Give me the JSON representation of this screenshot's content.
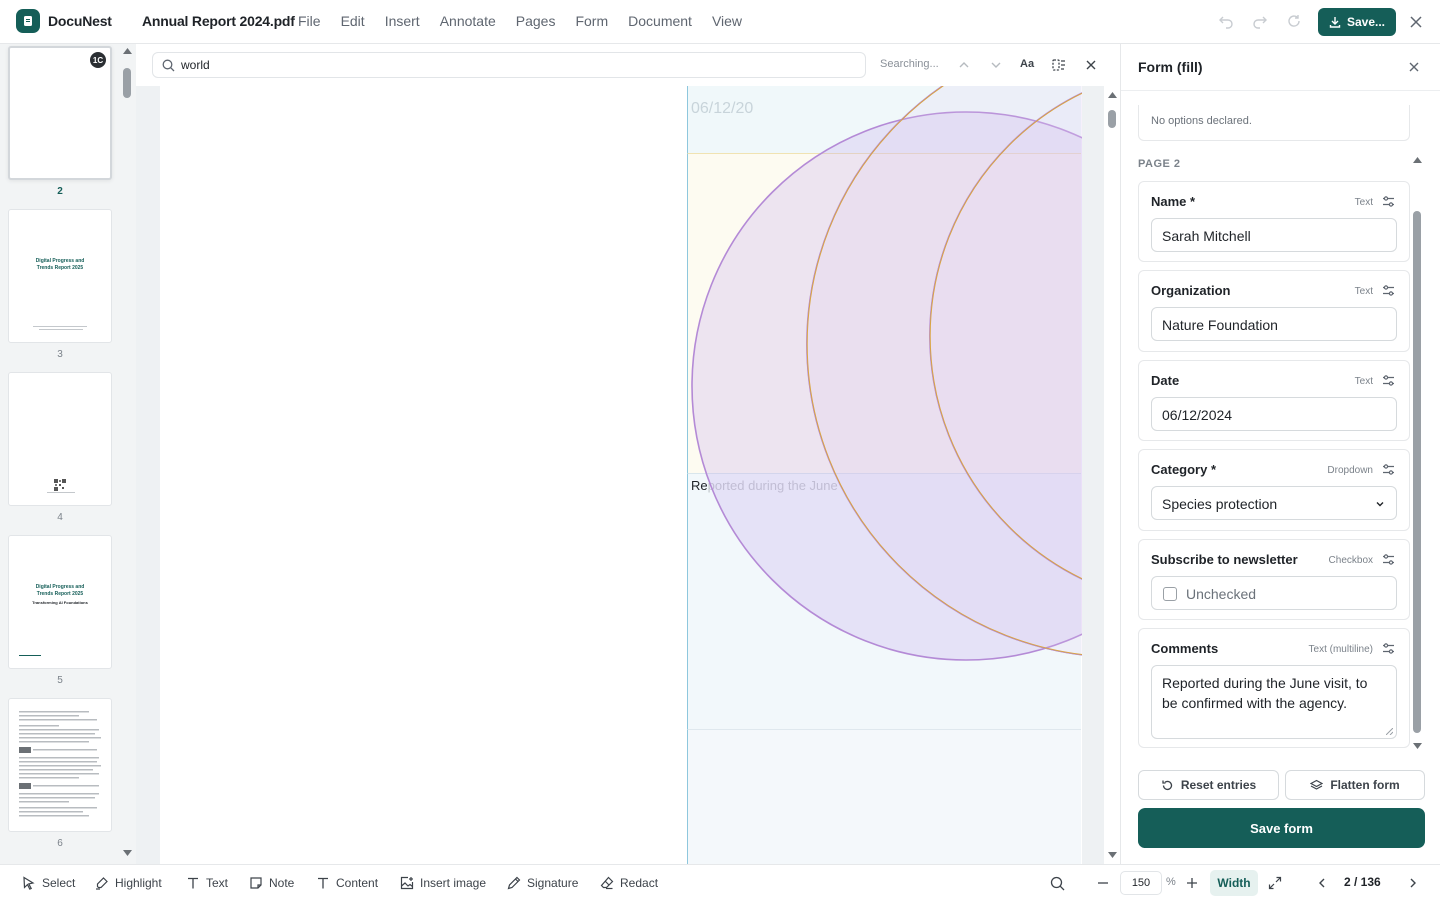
{
  "app": {
    "name": "DocuNest",
    "document": "Annual Report 2024.pdf"
  },
  "menu": [
    "File",
    "Edit",
    "Insert",
    "Annotate",
    "Pages",
    "Form",
    "Document",
    "View"
  ],
  "toolbar_top": {
    "save_label": "Save..."
  },
  "search": {
    "query": "world",
    "status": "Searching...",
    "match_case_label": "Aa"
  },
  "thumbnails": [
    {
      "page": "2",
      "badge": "1C",
      "active": true
    },
    {
      "page": "3",
      "title": "Digital Progress and Trends Report 2025"
    },
    {
      "page": "4"
    },
    {
      "page": "5",
      "title": "Digital Progress and Trends Report 2025",
      "subtitle": "Transforming AI Foundations"
    },
    {
      "page": "6"
    }
  ],
  "canvas": {
    "ghost_date": "06/12/20",
    "ghost_comment_typed": "Re",
    "ghost_comment_rest": "ported during the June"
  },
  "panel": {
    "title": "Form (fill)",
    "no_options": "No options declared.",
    "page_label": "PAGE 2",
    "fields": {
      "name": {
        "label": "Name *",
        "type": "Text",
        "value": "Sarah Mitchell"
      },
      "organization": {
        "label": "Organization",
        "type": "Text",
        "value": "Nature Foundation"
      },
      "date": {
        "label": "Date",
        "type": "Text",
        "value": "06/12/2024"
      },
      "category": {
        "label": "Category *",
        "type": "Dropdown",
        "value": "Species protection"
      },
      "newsletter": {
        "label": "Subscribe to newsletter",
        "type": "Checkbox",
        "value": "Unchecked"
      },
      "comments": {
        "label": "Comments",
        "type": "Text (multiline)",
        "value": "Reported during the June visit, to be confirmed with the agency."
      }
    },
    "reset_label": "Reset entries",
    "flatten_label": "Flatten form",
    "save_label": "Save form"
  },
  "bottom": {
    "tools": [
      "Select",
      "Highlight",
      "Text",
      "Note",
      "Content",
      "Insert image",
      "Signature",
      "Redact"
    ],
    "zoom": "150",
    "zoom_unit": "%",
    "fit_label": "Width",
    "page_indicator": "2 / 136"
  },
  "colors": {
    "accent": "#155e58",
    "accent_light": "#e6f1ef",
    "circle_stroke_a": "#b48ad6",
    "circle_stroke_b": "#d9a441"
  }
}
